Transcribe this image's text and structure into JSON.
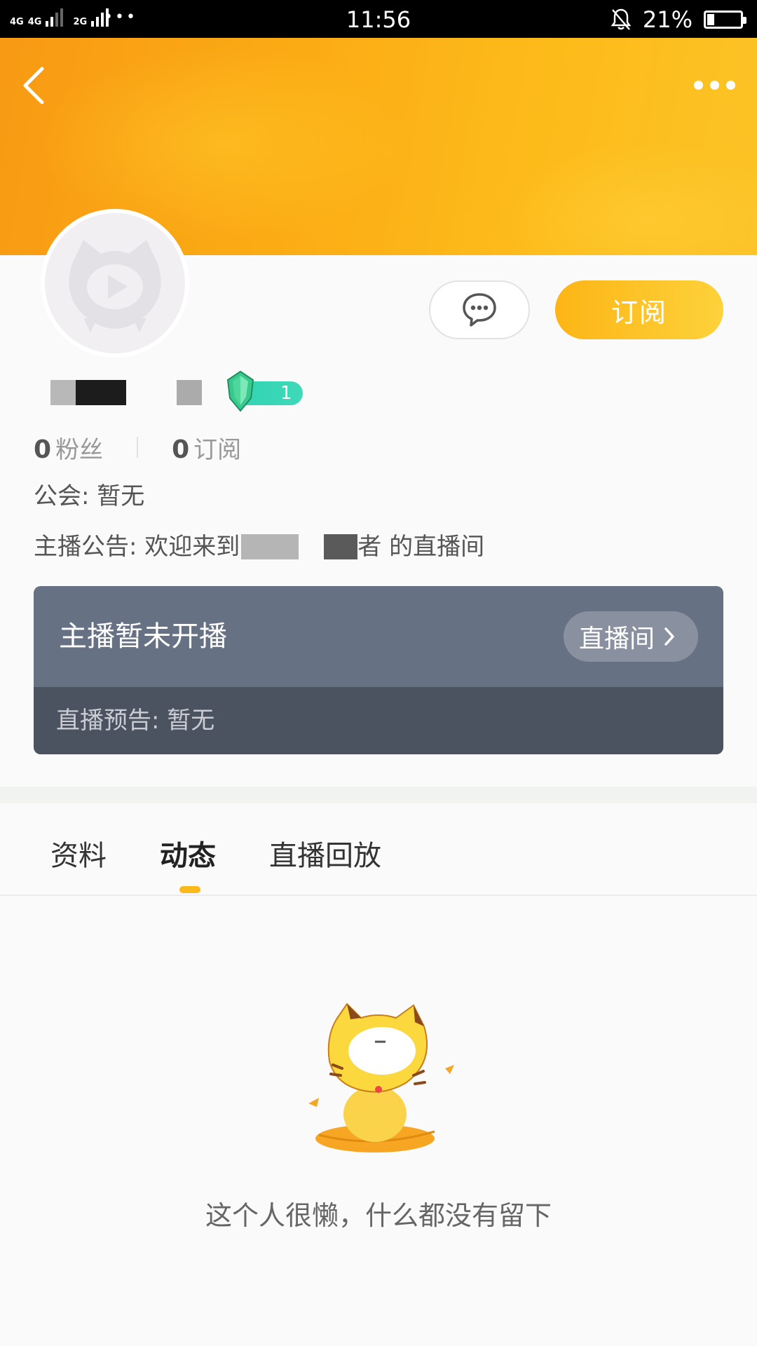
{
  "status_bar": {
    "signal_1": "4G",
    "signal_2": "4G",
    "signal_3": "2G",
    "dots": "•••",
    "time": "11:56",
    "battery_percent": "21%",
    "battery_level": 0.21
  },
  "header": {
    "back_icon": "chevron-left-icon",
    "more_icon": "more-dots-icon"
  },
  "profile": {
    "chat_icon": "chat-bubble-icon",
    "subscribe_label": "订阅",
    "level": "1",
    "fans_count": "0",
    "fans_label": "粉丝",
    "subscriptions_count": "0",
    "subscriptions_label": "订阅",
    "guild_text": "公会: 暂无",
    "notice_prefix": "主播公告: 欢迎来到",
    "notice_suffix": "者 的直播间"
  },
  "live": {
    "status": "主播暂未开播",
    "room_button": "直播间",
    "preview": "直播预告:  暂无"
  },
  "tabs": [
    {
      "label": "资料",
      "active": false
    },
    {
      "label": "动态",
      "active": true
    },
    {
      "label": "直播回放",
      "active": false
    }
  ],
  "empty_state": {
    "text": "这个人很懒，什么都没有留下"
  },
  "colors": {
    "accent": "#fdb515",
    "banner": "#f89a14",
    "card_top": "#677184",
    "card_bottom": "#4b5360",
    "level_badge": "#2fd3b3"
  }
}
